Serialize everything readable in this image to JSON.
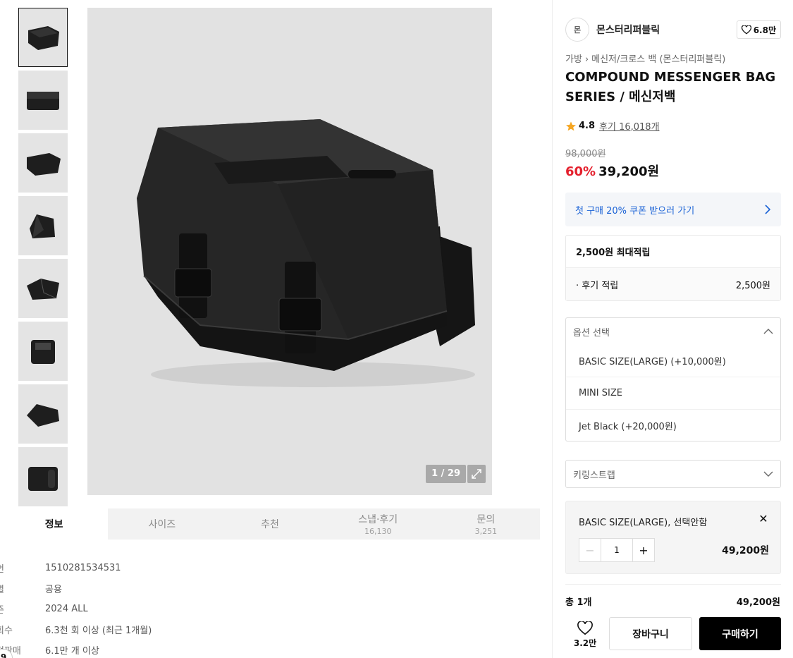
{
  "gallery": {
    "thumbnails": [
      {
        "alt": "thumb-1"
      },
      {
        "alt": "thumb-2"
      },
      {
        "alt": "thumb-3"
      },
      {
        "alt": "thumb-4"
      },
      {
        "alt": "thumb-5"
      },
      {
        "alt": "thumb-6"
      },
      {
        "alt": "thumb-7"
      },
      {
        "alt": "thumb-8"
      }
    ],
    "counter": "1 / 29"
  },
  "tabs": [
    {
      "label": "정보",
      "sub": ""
    },
    {
      "label": "사이즈",
      "sub": ""
    },
    {
      "label": "추천",
      "sub": ""
    },
    {
      "label": "스냅·후기",
      "sub": "16,130"
    },
    {
      "label": "문의",
      "sub": "3,251"
    }
  ],
  "info": [
    {
      "key": "번",
      "value": "1510281534531"
    },
    {
      "key": "별",
      "value": "공용"
    },
    {
      "key": "즌",
      "value": "2024 ALL"
    },
    {
      "key": "회수",
      "value": "6.3천 회 이상 (최근 1개월)"
    },
    {
      "key": "적판매",
      "value": "6.1만 개 이상"
    }
  ],
  "corner_badge": "9",
  "brand": {
    "logo_text": "몬",
    "name": "몬스터리퍼블릭",
    "likes": "6.8만"
  },
  "breadcrumb": {
    "category": "가방",
    "subcategory": "메신저/크로스 백 (몬스터리퍼블릭)"
  },
  "product": {
    "title": "COMPOUND MESSENGER BAG SERIES / 메신저백",
    "rating": "4.8",
    "reviews": "후기 16,018개",
    "original_price": "98,000원",
    "discount": "60%",
    "price": "39,200원"
  },
  "coupon": {
    "label": "첫 구매 20% 쿠폰 받으러 가기"
  },
  "points": {
    "head": "2,500원 최대적립",
    "row_label": "· 후기 적립",
    "row_value": "2,500원"
  },
  "option_select": {
    "placeholder": "옵션 선택",
    "options": [
      "BASIC SIZE(LARGE) (+10,000원)",
      "MINI SIZE",
      "Jet Black (+20,000원)"
    ]
  },
  "keyring_select": {
    "placeholder": "키링스트랩"
  },
  "selected_item": {
    "name": "BASIC SIZE(LARGE), 선택안함",
    "quantity": "1",
    "price": "49,200원"
  },
  "total": {
    "label": "총 1개",
    "price": "49,200원"
  },
  "actions": {
    "likes": "3.2만",
    "cart_label": "장바구니",
    "buy_label": "구매하기"
  },
  "colors": {
    "accent_red": "#e4202d",
    "coupon_blue": "#1a62d6",
    "star": "#f5a623"
  }
}
